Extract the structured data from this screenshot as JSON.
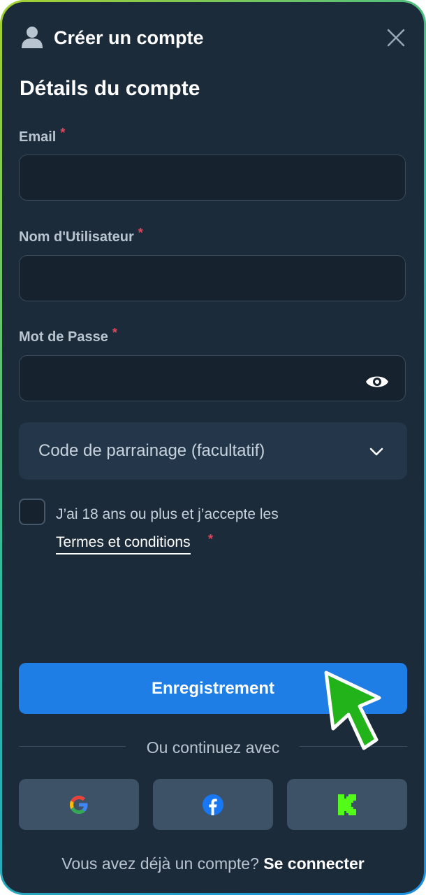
{
  "header": {
    "title": "Créer un compte",
    "icon": "user-icon",
    "close_icon": "close-icon"
  },
  "section_title": "Détails du compte",
  "fields": {
    "email": {
      "label": "Email",
      "required_mark": "*",
      "value": ""
    },
    "username": {
      "label": "Nom d'Utilisateur",
      "required_mark": "*",
      "value": ""
    },
    "password": {
      "label": "Mot de Passe",
      "required_mark": "*",
      "value": "",
      "toggle_icon": "eye-icon"
    }
  },
  "referral": {
    "label": "Code de parrainage (facultatif)",
    "icon": "chevron-down-icon"
  },
  "terms": {
    "text": "J’ai 18 ans ou plus et j’accepte les",
    "link": "Termes et conditions",
    "required_mark": "*",
    "checked": false
  },
  "register_button": "Enregistrement",
  "divider_text": "Ou continuez avec",
  "social": [
    {
      "name": "Google",
      "icon": "google-icon"
    },
    {
      "name": "Facebook",
      "icon": "facebook-icon"
    },
    {
      "name": "Kick",
      "icon": "kick-icon"
    }
  ],
  "footer": {
    "text": "Vous avez déjà un compte?",
    "link": "Se connecter"
  },
  "colors": {
    "background": "#1b2b3a",
    "input_bg": "#16222d",
    "primary_button": "#1f7de6",
    "social_button": "#3d5266",
    "required": "#e0475b",
    "cursor": "#22b21a"
  }
}
